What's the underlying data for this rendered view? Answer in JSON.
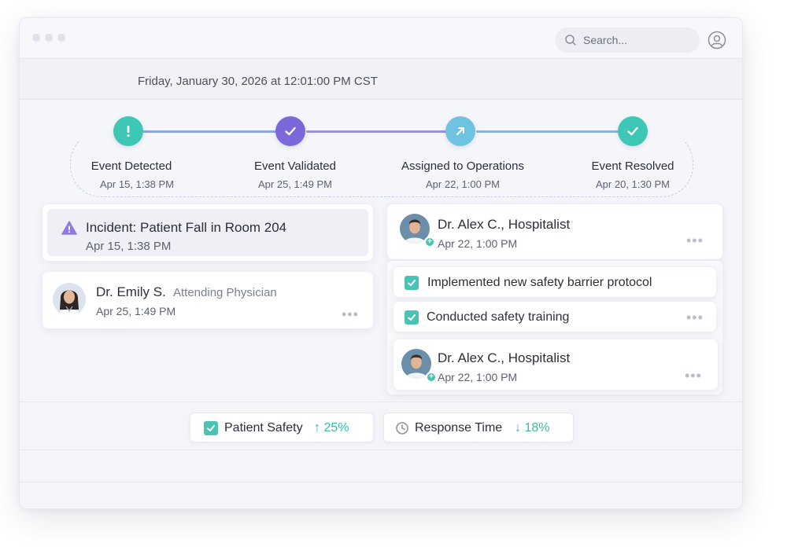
{
  "search": {
    "placeholder": "Search..."
  },
  "header": {
    "datetime": "Friday, January 30, 2026 at 12:01:00 PM CST"
  },
  "timeline": {
    "steps": [
      {
        "label": "Event Detected",
        "date": "Apr 15, 1:38 PM",
        "icon": "exclamation-icon",
        "color": "#3ec7b4"
      },
      {
        "label": "Event Validated",
        "date": "Apr 25, 1:49 PM",
        "icon": "check-icon",
        "color": "#7c68d9"
      },
      {
        "label": "Assigned to Operations",
        "date": "Apr 22, 1:00 PM",
        "icon": "arrow-up-right-icon",
        "color": "#6fc3e0"
      },
      {
        "label": "Event Resolved",
        "date": "Apr 20, 1:30 PM",
        "icon": "check-icon",
        "color": "#3ec7b4"
      }
    ]
  },
  "incident": {
    "title": "Incident: Patient Fall in Room 204",
    "date": "Apr 15, 1:38 PM",
    "icon": "warning-icon"
  },
  "validator": {
    "name": "Dr. Emily S.",
    "role": "Attending Physician",
    "date": "Apr 25, 1:49 PM"
  },
  "assignee_top": {
    "name": "Dr. Alex C., Hospitalist",
    "date": "Apr 22, 1:00 PM"
  },
  "tasks": [
    {
      "text": "Implemented new safety barrier protocol",
      "checked": true
    },
    {
      "text": "Conducted safety training",
      "checked": true
    }
  ],
  "assignee_bottom": {
    "name": "Dr. Alex C., Hospitalist",
    "date": "Apr 22, 1:00 PM"
  },
  "metrics": [
    {
      "label": "Patient Safety",
      "value": "↑ 25%",
      "icon": "checkbox-icon"
    },
    {
      "label": "Response Time",
      "value": "↓ 18%",
      "icon": "clock-icon"
    }
  ],
  "more_label": "•••",
  "colors": {
    "accent_teal": "#3ec7b4",
    "accent_purple": "#7c68d9",
    "accent_blue": "#6fc3e0"
  }
}
